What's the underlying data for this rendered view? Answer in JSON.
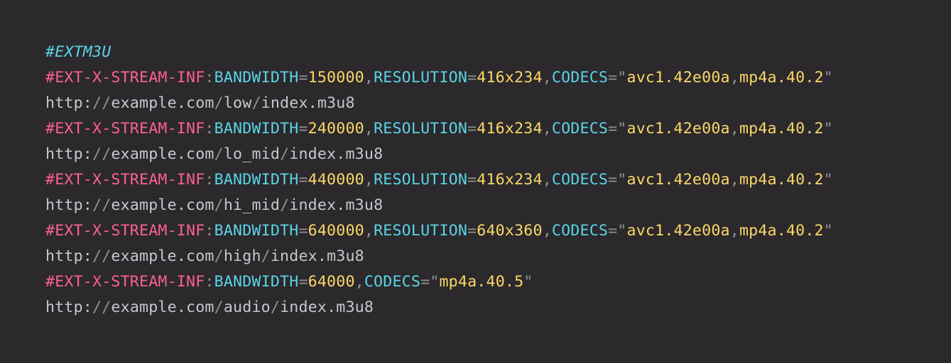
{
  "editor": {
    "colors": {
      "background": "#2b292c",
      "comment": "#5ad4e6",
      "tag": "#fc618d",
      "key": "#5ad4e6",
      "punctuation": "#939293",
      "value": "#fcd866",
      "url": "#c9c7cc"
    },
    "lines": [
      [
        {
          "t": "#EXTM3U",
          "c": "comment"
        }
      ],
      [
        {
          "t": "#EXT-X-STREAM-INF",
          "c": "tag"
        },
        {
          "t": ":",
          "c": "punct"
        },
        {
          "t": "BANDWIDTH",
          "c": "key"
        },
        {
          "t": "=",
          "c": "punct"
        },
        {
          "t": "150000",
          "c": "num"
        },
        {
          "t": ",",
          "c": "punct"
        },
        {
          "t": "RESOLUTION",
          "c": "key"
        },
        {
          "t": "=",
          "c": "punct"
        },
        {
          "t": "416x234",
          "c": "num"
        },
        {
          "t": ",",
          "c": "punct"
        },
        {
          "t": "CODECS",
          "c": "key"
        },
        {
          "t": "=\"",
          "c": "punct"
        },
        {
          "t": "avc1.42e00a",
          "c": "str"
        },
        {
          "t": ",",
          "c": "punct"
        },
        {
          "t": "mp4a.40.2",
          "c": "str"
        },
        {
          "t": "\"",
          "c": "punct"
        }
      ],
      [
        {
          "t": "http:",
          "c": "url"
        },
        {
          "t": "//",
          "c": "url-slash"
        },
        {
          "t": "example.com",
          "c": "url"
        },
        {
          "t": "/",
          "c": "url-slash"
        },
        {
          "t": "low",
          "c": "url"
        },
        {
          "t": "/",
          "c": "url-slash"
        },
        {
          "t": "index.m3u8",
          "c": "url"
        }
      ],
      [
        {
          "t": "#EXT-X-STREAM-INF",
          "c": "tag"
        },
        {
          "t": ":",
          "c": "punct"
        },
        {
          "t": "BANDWIDTH",
          "c": "key"
        },
        {
          "t": "=",
          "c": "punct"
        },
        {
          "t": "240000",
          "c": "num"
        },
        {
          "t": ",",
          "c": "punct"
        },
        {
          "t": "RESOLUTION",
          "c": "key"
        },
        {
          "t": "=",
          "c": "punct"
        },
        {
          "t": "416x234",
          "c": "num"
        },
        {
          "t": ",",
          "c": "punct"
        },
        {
          "t": "CODECS",
          "c": "key"
        },
        {
          "t": "=\"",
          "c": "punct"
        },
        {
          "t": "avc1.42e00a",
          "c": "str"
        },
        {
          "t": ",",
          "c": "punct"
        },
        {
          "t": "mp4a.40.2",
          "c": "str"
        },
        {
          "t": "\"",
          "c": "punct"
        }
      ],
      [
        {
          "t": "http:",
          "c": "url"
        },
        {
          "t": "//",
          "c": "url-slash"
        },
        {
          "t": "example.com",
          "c": "url"
        },
        {
          "t": "/",
          "c": "url-slash"
        },
        {
          "t": "lo_mid",
          "c": "url"
        },
        {
          "t": "/",
          "c": "url-slash"
        },
        {
          "t": "index.m3u8",
          "c": "url"
        }
      ],
      [
        {
          "t": "#EXT-X-STREAM-INF",
          "c": "tag"
        },
        {
          "t": ":",
          "c": "punct"
        },
        {
          "t": "BANDWIDTH",
          "c": "key"
        },
        {
          "t": "=",
          "c": "punct"
        },
        {
          "t": "440000",
          "c": "num"
        },
        {
          "t": ",",
          "c": "punct"
        },
        {
          "t": "RESOLUTION",
          "c": "key"
        },
        {
          "t": "=",
          "c": "punct"
        },
        {
          "t": "416x234",
          "c": "num"
        },
        {
          "t": ",",
          "c": "punct"
        },
        {
          "t": "CODECS",
          "c": "key"
        },
        {
          "t": "=\"",
          "c": "punct"
        },
        {
          "t": "avc1.42e00a",
          "c": "str"
        },
        {
          "t": ",",
          "c": "punct"
        },
        {
          "t": "mp4a.40.2",
          "c": "str"
        },
        {
          "t": "\"",
          "c": "punct"
        }
      ],
      [
        {
          "t": "http:",
          "c": "url"
        },
        {
          "t": "//",
          "c": "url-slash"
        },
        {
          "t": "example.com",
          "c": "url"
        },
        {
          "t": "/",
          "c": "url-slash"
        },
        {
          "t": "hi_mid",
          "c": "url"
        },
        {
          "t": "/",
          "c": "url-slash"
        },
        {
          "t": "index.m3u8",
          "c": "url"
        }
      ],
      [
        {
          "t": "#EXT-X-STREAM-INF",
          "c": "tag"
        },
        {
          "t": ":",
          "c": "punct"
        },
        {
          "t": "BANDWIDTH",
          "c": "key"
        },
        {
          "t": "=",
          "c": "punct"
        },
        {
          "t": "640000",
          "c": "num"
        },
        {
          "t": ",",
          "c": "punct"
        },
        {
          "t": "RESOLUTION",
          "c": "key"
        },
        {
          "t": "=",
          "c": "punct"
        },
        {
          "t": "640x360",
          "c": "num"
        },
        {
          "t": ",",
          "c": "punct"
        },
        {
          "t": "CODECS",
          "c": "key"
        },
        {
          "t": "=\"",
          "c": "punct"
        },
        {
          "t": "avc1.42e00a",
          "c": "str"
        },
        {
          "t": ",",
          "c": "punct"
        },
        {
          "t": "mp4a.40.2",
          "c": "str"
        },
        {
          "t": "\"",
          "c": "punct"
        }
      ],
      [
        {
          "t": "http:",
          "c": "url"
        },
        {
          "t": "//",
          "c": "url-slash"
        },
        {
          "t": "example.com",
          "c": "url"
        },
        {
          "t": "/",
          "c": "url-slash"
        },
        {
          "t": "high",
          "c": "url"
        },
        {
          "t": "/",
          "c": "url-slash"
        },
        {
          "t": "index.m3u8",
          "c": "url"
        }
      ],
      [
        {
          "t": "#EXT-X-STREAM-INF",
          "c": "tag"
        },
        {
          "t": ":",
          "c": "punct"
        },
        {
          "t": "BANDWIDTH",
          "c": "key"
        },
        {
          "t": "=",
          "c": "punct"
        },
        {
          "t": "64000",
          "c": "num"
        },
        {
          "t": ",",
          "c": "punct"
        },
        {
          "t": "CODECS",
          "c": "key"
        },
        {
          "t": "=\"",
          "c": "punct"
        },
        {
          "t": "mp4a.40.5",
          "c": "str"
        },
        {
          "t": "\"",
          "c": "punct"
        }
      ],
      [
        {
          "t": "http:",
          "c": "url"
        },
        {
          "t": "//",
          "c": "url-slash"
        },
        {
          "t": "example.com",
          "c": "url"
        },
        {
          "t": "/",
          "c": "url-slash"
        },
        {
          "t": "audio",
          "c": "url"
        },
        {
          "t": "/",
          "c": "url-slash"
        },
        {
          "t": "index.m3u8",
          "c": "url"
        }
      ]
    ]
  }
}
